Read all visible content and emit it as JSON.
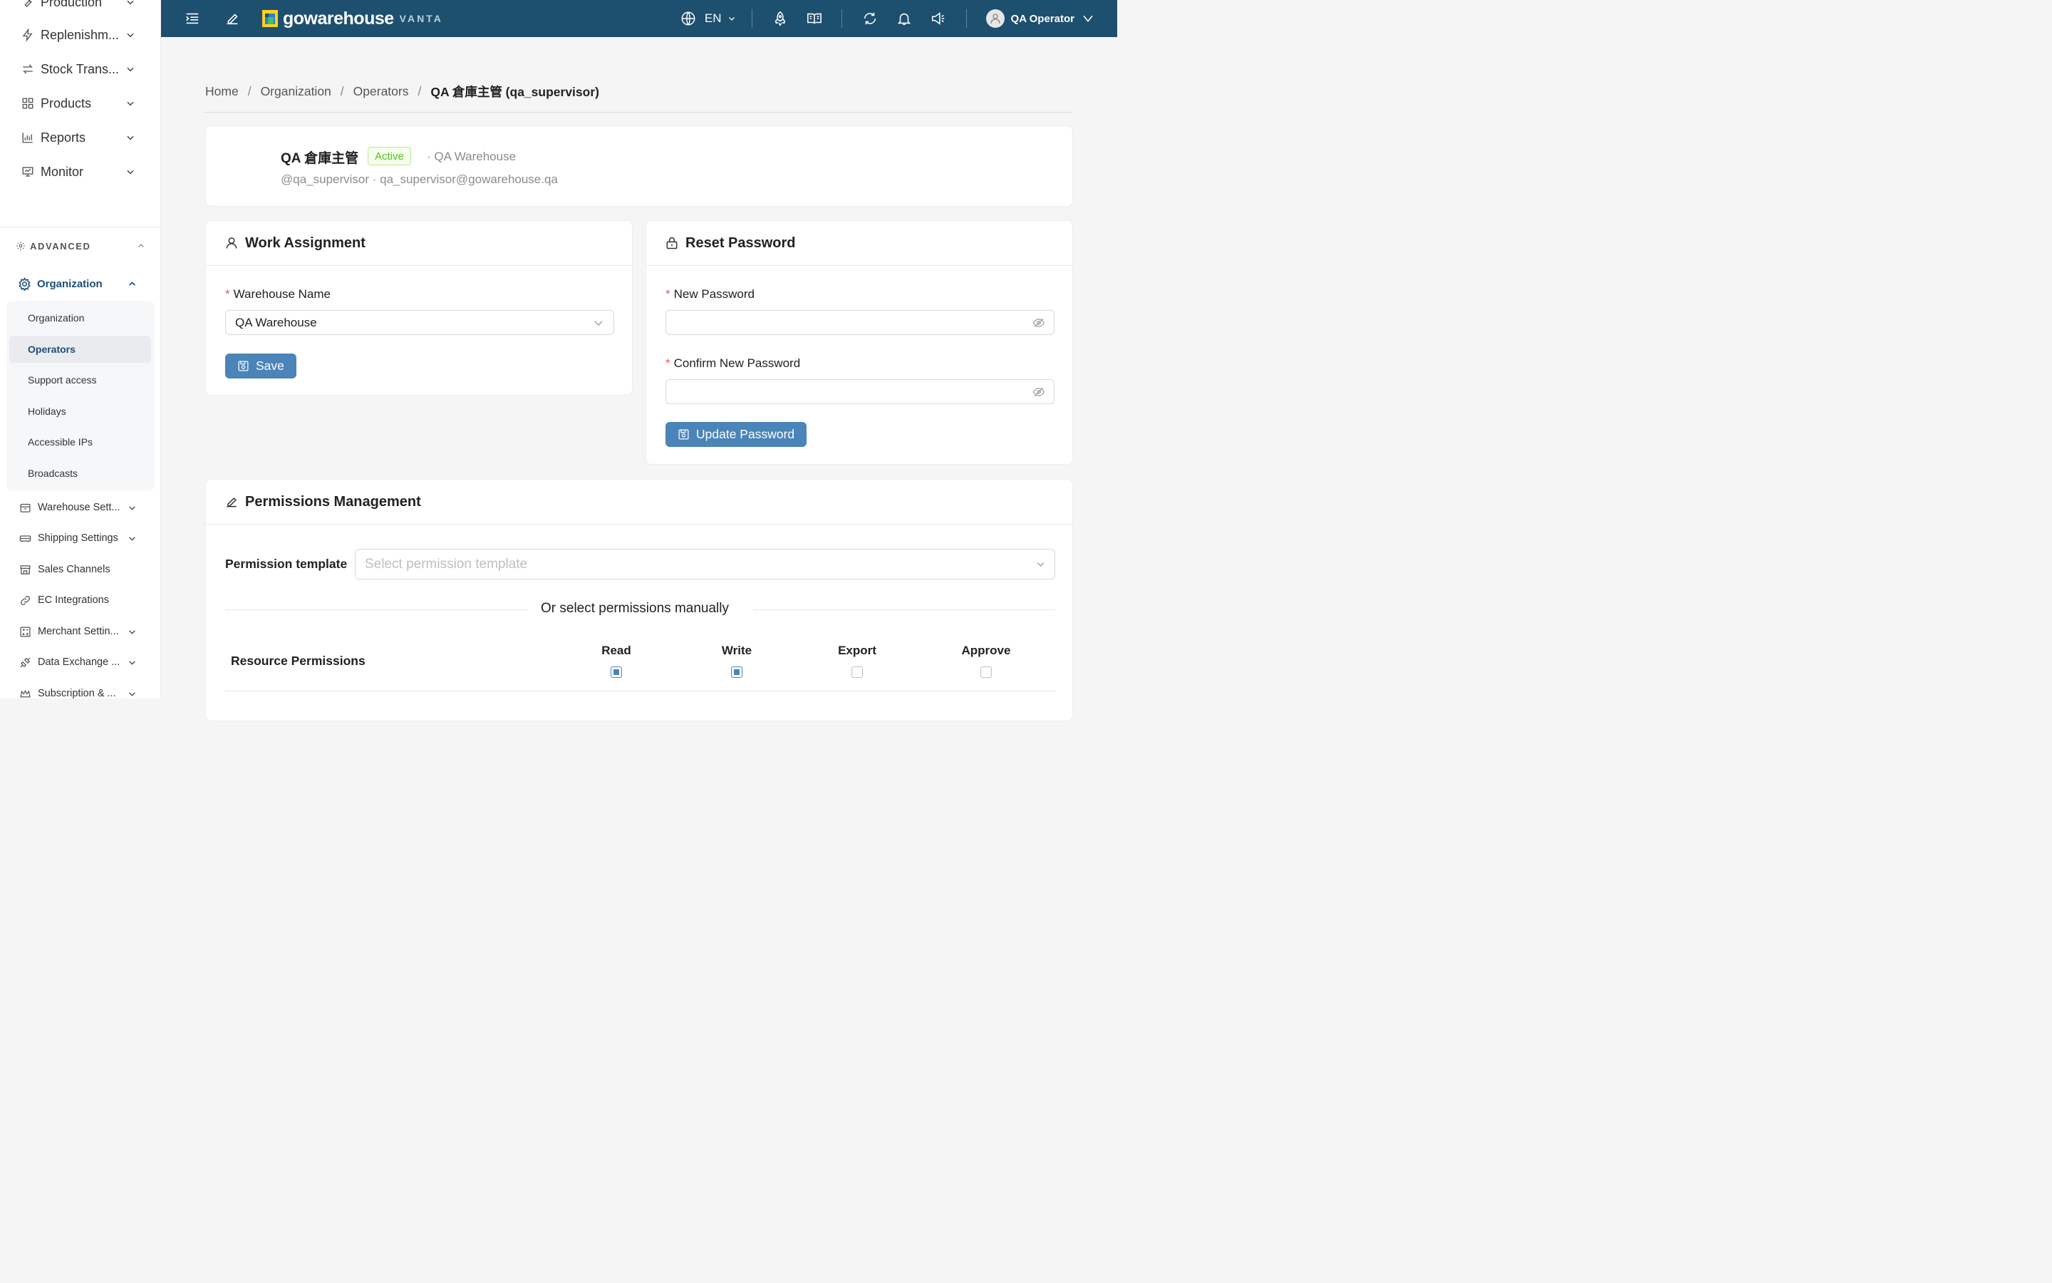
{
  "sidebar": {
    "top_items": [
      {
        "label": "Production",
        "icon": "wrench-icon"
      },
      {
        "label": "Replenishm...",
        "icon": "lightning-icon"
      },
      {
        "label": "Stock Trans...",
        "icon": "transfer-icon"
      },
      {
        "label": "Products",
        "icon": "grid-icon"
      },
      {
        "label": "Reports",
        "icon": "bar-chart-icon"
      },
      {
        "label": "Monitor",
        "icon": "monitor-icon"
      }
    ],
    "advanced": {
      "label": "ADVANCED"
    },
    "organization": {
      "label": "Organization",
      "subitems": [
        {
          "label": "Organization"
        },
        {
          "label": "Operators",
          "active": true
        },
        {
          "label": "Support access"
        },
        {
          "label": "Holidays"
        },
        {
          "label": "Accessible IPs"
        },
        {
          "label": "Broadcasts"
        }
      ]
    },
    "lower_items": [
      {
        "label": "Warehouse Sett...",
        "icon": "box-icon",
        "has_children": true
      },
      {
        "label": "Shipping Settings",
        "icon": "truck-icon",
        "has_children": true
      },
      {
        "label": "Sales Channels",
        "icon": "store-icon",
        "has_children": false
      },
      {
        "label": "EC Integrations",
        "icon": "link-icon",
        "has_children": false
      },
      {
        "label": "Merchant Settin...",
        "icon": "calculator-icon",
        "has_children": true
      },
      {
        "label": "Data Exchange ...",
        "icon": "api-icon",
        "has_children": true
      },
      {
        "label": "Subscription & ...",
        "icon": "crown-icon",
        "has_children": true
      }
    ]
  },
  "topbar": {
    "brand_name": "gowarehouse",
    "brand_tag": "VANTA",
    "language": "EN",
    "user": "QA Operator"
  },
  "breadcrumb": {
    "items": [
      "Home",
      "Organization",
      "Operators"
    ],
    "current": "QA 倉庫主管 (qa_supervisor)",
    "separator": "/"
  },
  "profile": {
    "name": "QA 倉庫主管",
    "status": "Active",
    "warehouse": "· QA Warehouse",
    "subtitle": "@qa_supervisor · qa_supervisor@gowarehouse.qa"
  },
  "work_assignment": {
    "title": "Work Assignment",
    "warehouse_label": "Warehouse Name",
    "warehouse_value": "QA Warehouse",
    "save_label": "Save"
  },
  "reset_password": {
    "title": "Reset Password",
    "new_label": "New Password",
    "confirm_label": "Confirm New Password",
    "new_value": "",
    "confirm_value": "",
    "button_label": "Update Password"
  },
  "permissions": {
    "title": "Permissions Management",
    "template_label": "Permission template",
    "template_placeholder": "Select permission template",
    "manual_divider": "Or select permissions manually",
    "resource_label": "Resource Permissions",
    "columns": [
      {
        "label": "Read",
        "checked": true
      },
      {
        "label": "Write",
        "checked": true
      },
      {
        "label": "Export",
        "checked": false
      },
      {
        "label": "Approve",
        "checked": false
      }
    ]
  },
  "colors": {
    "topbar": "#1d4f6f",
    "primary_button": "#4a84b8",
    "active_nav": "#1e4e79",
    "status_green": "#52c41a"
  }
}
